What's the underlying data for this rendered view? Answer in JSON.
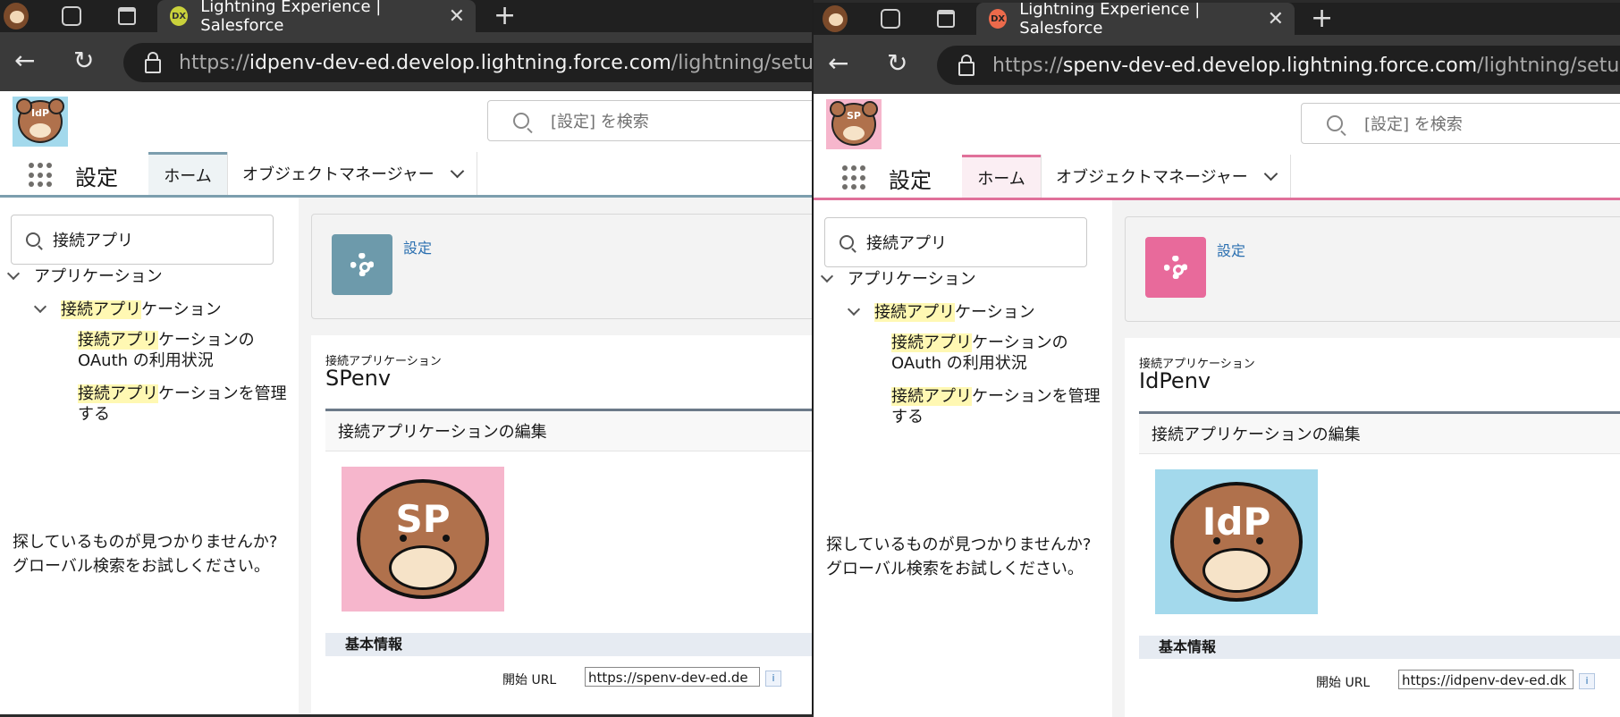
{
  "windows": [
    {
      "tab": {
        "title": "Lightning Experience | Salesforce",
        "favicon": "DX",
        "favicon_color": "#c9d13b"
      },
      "url": {
        "prefix": "https://",
        "host": "idpenv-dev-ed.develop.lightning.force.com",
        "path": "/lightning/setup/Connec"
      },
      "logo_text": "IdP",
      "logo_bg": "#a3d9ec",
      "search_placeholder": "[設定] を検索",
      "app_name": "設定",
      "nav": {
        "home": "ホーム",
        "object_manager": "オブジェクトマネージャー"
      },
      "quick_find_value": "接続アプリ",
      "tree": {
        "root": "アプリケーション",
        "child": {
          "hl": "接続アプリ",
          "rest": "ケーション"
        },
        "item1": {
          "hl": "接続アプリ",
          "rest": "ケーションの",
          "line2": "OAuth の利用状況"
        },
        "item2": {
          "hl": "接続アプリ",
          "rest": "ケーションを管理",
          "line2": "する"
        }
      },
      "help": {
        "line1": "探しているものが見つかりませんか?",
        "line2": "グローバル検索をお試しください。"
      },
      "breadcrumb": "設定",
      "object_label": "接続アプリケーション",
      "record_name": "SPenv",
      "section_title": "接続アプリケーションの編集",
      "app_logo_text": "SP",
      "info_section": "基本情報",
      "start_url_label": "開始 URL",
      "start_url_value": "https://spenv-dev-ed.de",
      "accent": "#7c9eae"
    },
    {
      "tab": {
        "title": "Lightning Experience | Salesforce",
        "favicon": "DX",
        "favicon_color": "#ec6a4b"
      },
      "url": {
        "prefix": "https://",
        "host": "spenv-dev-ed.develop.lightning.force.com",
        "path": "/lightning/setup/Connec"
      },
      "logo_text": "SP",
      "logo_bg": "#f6b6cc",
      "search_placeholder": "[設定] を検索",
      "app_name": "設定",
      "nav": {
        "home": "ホーム",
        "object_manager": "オブジェクトマネージャー"
      },
      "quick_find_value": "接続アプリ",
      "tree": {
        "root": "アプリケーション",
        "child": {
          "hl": "接続アプリ",
          "rest": "ケーション"
        },
        "item1": {
          "hl": "接続アプリ",
          "rest": "ケーションの",
          "line2": "OAuth の利用状況"
        },
        "item2": {
          "hl": "接続アプリ",
          "rest": "ケーションを管理",
          "line2": "する"
        }
      },
      "help": {
        "line1": "探しているものが見つかりませんか?",
        "line2": "グローバル検索をお試しください。"
      },
      "breadcrumb": "設定",
      "object_label": "接続アプリケーション",
      "record_name": "IdPenv",
      "section_title": "接続アプリケーションの編集",
      "app_logo_text": "IdP",
      "info_section": "基本情報",
      "start_url_label": "開始 URL",
      "start_url_value": "https://idpenv-dev-ed.dk",
      "accent": "#e0709a"
    }
  ],
  "icons": [
    "profile-avatar-icon",
    "workspaces-icon",
    "tab-actions-icon",
    "new-tab-icon",
    "back-icon",
    "refresh-icon",
    "lock-icon",
    "search-icon",
    "app-launcher-icon",
    "chevron-down-icon",
    "gear-icon",
    "info-icon"
  ]
}
